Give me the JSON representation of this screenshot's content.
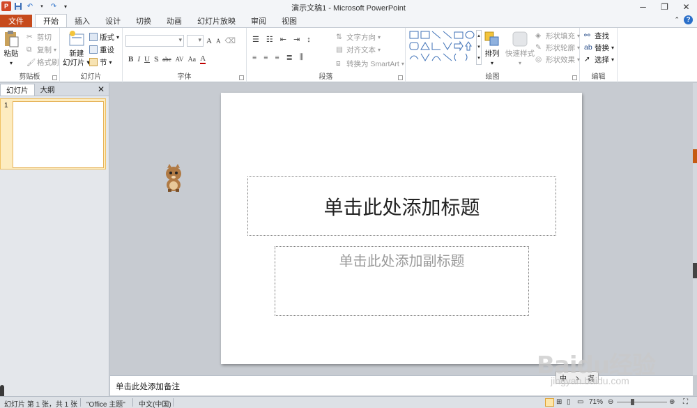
{
  "app": {
    "window_title": "演示文稿1 - Microsoft PowerPoint"
  },
  "qat": {
    "items": [
      "powerpoint-icon",
      "save-icon",
      "undo-icon",
      "redo-icon",
      "customize-icon"
    ],
    "app_letter": "P"
  },
  "tabs": {
    "file": "文件",
    "items": [
      "开始",
      "插入",
      "设计",
      "切换",
      "动画",
      "幻灯片放映",
      "审阅",
      "视图"
    ],
    "active": "开始"
  },
  "ribbon": {
    "clipboard": {
      "label": "剪贴板",
      "paste": "粘贴",
      "cut": "剪切",
      "copy": "复制",
      "format_painter": "格式刷"
    },
    "slides": {
      "label": "幻灯片",
      "new_slide_line1": "新建",
      "new_slide_line2": "幻灯片",
      "layout": "版式",
      "reset": "重设",
      "section": "节"
    },
    "font": {
      "label": "字体",
      "bold": "B",
      "italic": "I",
      "underline": "U",
      "shadow": "S",
      "strikethrough": "abc",
      "spacing": "AV",
      "change_case": "Aa",
      "grow": "A",
      "shrink": "A"
    },
    "paragraph": {
      "label": "段落",
      "text_direction": "文字方向",
      "align_text": "对齐文本",
      "convert_smartart": "转换为 SmartArt"
    },
    "drawing": {
      "label": "绘图",
      "arrange": "排列",
      "quick_styles": "快速样式",
      "shape_fill": "形状填充",
      "shape_outline": "形状轮廓",
      "shape_effects": "形状效果"
    },
    "editing": {
      "label": "编辑",
      "find": "查找",
      "replace": "替换",
      "select": "选择"
    }
  },
  "left_panel": {
    "tab_slides": "幻灯片",
    "tab_outline": "大纲",
    "close": "✕",
    "slide_number": "1"
  },
  "slide": {
    "title_placeholder": "单击此处添加标题",
    "subtitle_placeholder": "单击此处添加副标题"
  },
  "notes": {
    "placeholder": "单击此处添加备注"
  },
  "status": {
    "slide_info": "幻灯片 第 1 张，共 1 张",
    "theme": "\"Office 主题\"",
    "language": "中文(中国)",
    "zoom": "71%"
  },
  "ime": {
    "chars": [
      "中",
      "ゝ",
      "㐂"
    ]
  },
  "watermark": {
    "text": "Baidu经验",
    "url": "jingyan.baidu.com"
  }
}
